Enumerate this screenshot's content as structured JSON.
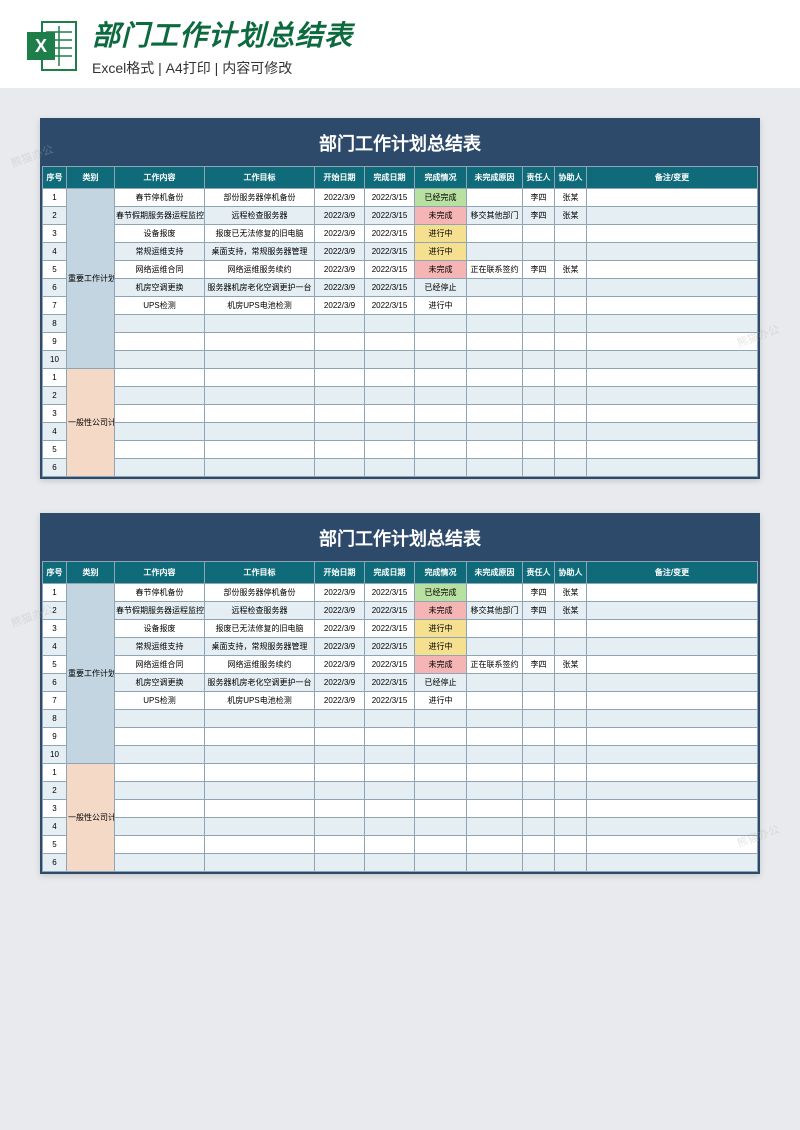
{
  "header": {
    "title": "部门工作计划总结表",
    "subtitle": "Excel格式 | A4打印 | 内容可修改"
  },
  "sheet": {
    "title": "部门工作计划总结表",
    "columns": [
      "序号",
      "类别",
      "工作内容",
      "工作目标",
      "开始日期",
      "完成日期",
      "完成情况",
      "未完成原因",
      "责任人",
      "协助人",
      "备注/变更"
    ],
    "cat1": "重要工作计划",
    "cat2": "一般性公司计划",
    "rows1": [
      {
        "seq": "1",
        "content": "春节停机备份",
        "target": "部份服务器停机备份",
        "start": "2022/3/9",
        "end": "2022/3/15",
        "status": "已经完成",
        "statusClass": "status-done",
        "reason": "",
        "resp": "李四",
        "assist": "张某"
      },
      {
        "seq": "2",
        "content": "春节假期服务器运程监控",
        "target": "远程检查服务器",
        "start": "2022/3/9",
        "end": "2022/3/15",
        "status": "未完成",
        "statusClass": "status-fail",
        "reason": "移交其他部门",
        "resp": "李四",
        "assist": "张某"
      },
      {
        "seq": "3",
        "content": "设备报废",
        "target": "报废已无法修复的旧电脑",
        "start": "2022/3/9",
        "end": "2022/3/15",
        "status": "进行中",
        "statusClass": "status-doing",
        "reason": "",
        "resp": "",
        "assist": ""
      },
      {
        "seq": "4",
        "content": "常规运维支持",
        "target": "桌面支持，常规服务器管理",
        "start": "2022/3/9",
        "end": "2022/3/15",
        "status": "进行中",
        "statusClass": "status-doing",
        "reason": "",
        "resp": "",
        "assist": ""
      },
      {
        "seq": "5",
        "content": "网络运维合同",
        "target": "网络运维服务续约",
        "start": "2022/3/9",
        "end": "2022/3/15",
        "status": "未完成",
        "statusClass": "status-fail",
        "reason": "正在联系签约",
        "resp": "李四",
        "assist": "张某"
      },
      {
        "seq": "6",
        "content": "机房空调更换",
        "target": "服务器机房老化空调更护一台",
        "start": "2022/3/9",
        "end": "2022/3/15",
        "status": "已经停止",
        "statusClass": "",
        "reason": "",
        "resp": "",
        "assist": ""
      },
      {
        "seq": "7",
        "content": "UPS检测",
        "target": "机房UPS电池检测",
        "start": "2022/3/9",
        "end": "2022/3/15",
        "status": "进行中",
        "statusClass": "",
        "reason": "",
        "resp": "",
        "assist": ""
      },
      {
        "seq": "8",
        "content": "",
        "target": "",
        "start": "",
        "end": "",
        "status": "",
        "statusClass": "",
        "reason": "",
        "resp": "",
        "assist": ""
      },
      {
        "seq": "9",
        "content": "",
        "target": "",
        "start": "",
        "end": "",
        "status": "",
        "statusClass": "",
        "reason": "",
        "resp": "",
        "assist": ""
      },
      {
        "seq": "10",
        "content": "",
        "target": "",
        "start": "",
        "end": "",
        "status": "",
        "statusClass": "",
        "reason": "",
        "resp": "",
        "assist": ""
      }
    ],
    "rows2": [
      {
        "seq": "1"
      },
      {
        "seq": "2"
      },
      {
        "seq": "3"
      },
      {
        "seq": "4"
      },
      {
        "seq": "5"
      },
      {
        "seq": "6"
      }
    ]
  },
  "watermark": "熊猫办公"
}
